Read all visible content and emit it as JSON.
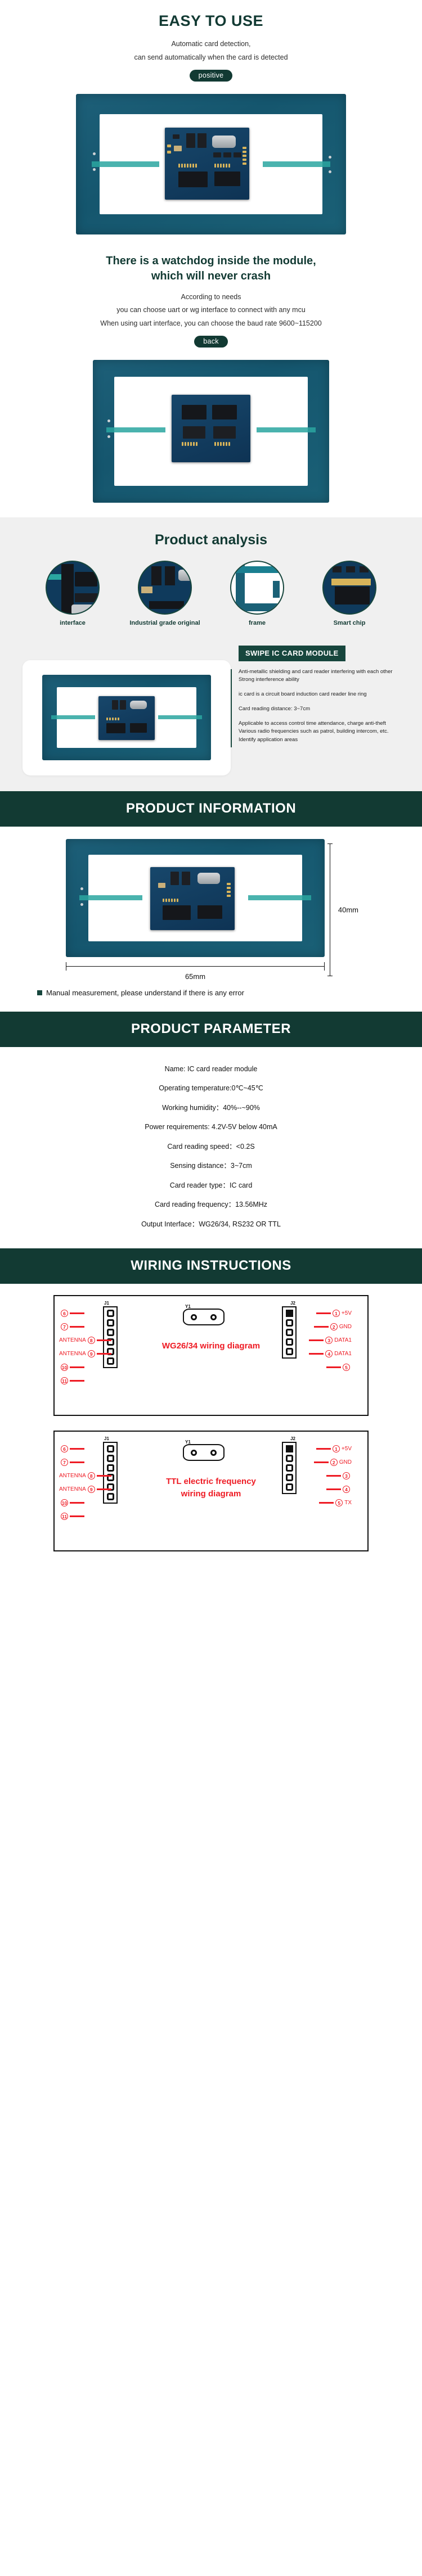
{
  "sections": {
    "easy_to_use": {
      "title": "EASY TO USE",
      "line1": "Automatic card detection,",
      "line2": "can send automatically when the card is detected",
      "badge": "positive"
    },
    "watchdog": {
      "title_line1": "There is a watchdog inside the module,",
      "title_line2": "which will never crash",
      "line1": "According to needs",
      "line2": "you can choose uart or wg interface to connect with any mcu",
      "line3": "When using uart interface, you can choose the baud rate 9600~115200",
      "badge": "back"
    },
    "product_analysis": {
      "title": "Product analysis",
      "items": [
        {
          "label": "interface"
        },
        {
          "label": "Industrial grade original"
        },
        {
          "label": "frame"
        },
        {
          "label": "Smart chip"
        }
      ]
    },
    "swipe_module": {
      "title": "SWIPE IC CARD MODULE",
      "paragraphs": [
        "Anti-metallic shielding and card reader interfering with each other Strong interference ability",
        "ic card is a circuit board induction card reader line ring",
        "Card reading distance: 3~7cm",
        "Applicable to access control time attendance, charge anti-theft Various radio frequencies such as patrol, building intercom, etc. Identify application areas"
      ]
    },
    "product_information": {
      "banner": "PRODUCT INFORMATION",
      "height_label": "40mm",
      "width_label": "65mm",
      "note": "Manual measurement, please understand if there is any error"
    },
    "product_parameter": {
      "banner": "PRODUCT PARAMETER",
      "rows": [
        "Name: IC card reader module",
        "Operating temperature:0℃~45℃",
        "Working humidity：40%--~90%",
        "Power requirements: 4.2V-5V below 40mA",
        "Card reading speed：<0.2S",
        "Sensing distance：3~7cm",
        "Card reader type：IC card",
        "Card reading frequency：13.56MHz",
        "Output Interface：WG26/34, RS232 OR TTL"
      ]
    },
    "wiring": {
      "banner": "WIRING INSTRUCTIONS",
      "diagrams": [
        {
          "title_line1": "WG26/34 wiring diagram",
          "title_line2": "",
          "left_header_tag": "J1",
          "right_header_tag": "J2",
          "crystal_tag": "Y1",
          "left_pins": [
            {
              "num": "6",
              "label": ""
            },
            {
              "num": "7",
              "label": ""
            },
            {
              "num": "8",
              "label": "ANTENNA"
            },
            {
              "num": "9",
              "label": "ANTENNA"
            },
            {
              "num": "10",
              "label": ""
            },
            {
              "num": "11",
              "label": ""
            }
          ],
          "right_pins": [
            {
              "num": "1",
              "label": "+5V"
            },
            {
              "num": "2",
              "label": "GND"
            },
            {
              "num": "3",
              "label": "DATA1"
            },
            {
              "num": "4",
              "label": "DATA1"
            },
            {
              "num": "5",
              "label": ""
            }
          ]
        },
        {
          "title_line1": "TTL electric frequency",
          "title_line2": "wiring diagram",
          "left_header_tag": "J1",
          "right_header_tag": "J2",
          "crystal_tag": "Y1",
          "left_pins": [
            {
              "num": "6",
              "label": ""
            },
            {
              "num": "7",
              "label": ""
            },
            {
              "num": "8",
              "label": "ANTENNA"
            },
            {
              "num": "9",
              "label": "ANTENNA"
            },
            {
              "num": "10",
              "label": ""
            },
            {
              "num": "11",
              "label": ""
            }
          ],
          "right_pins": [
            {
              "num": "1",
              "label": "+5V"
            },
            {
              "num": "2",
              "label": "GND"
            },
            {
              "num": "3",
              "label": ""
            },
            {
              "num": "4",
              "label": ""
            },
            {
              "num": "5",
              "label": "TX"
            }
          ]
        }
      ]
    }
  },
  "colors": {
    "brand_dark": "#123a33",
    "banner_dark": "#17463d",
    "accent_red": "#ee1b24",
    "pcb_blue": "#1a6076",
    "grey_bg": "#f0f0f0"
  }
}
